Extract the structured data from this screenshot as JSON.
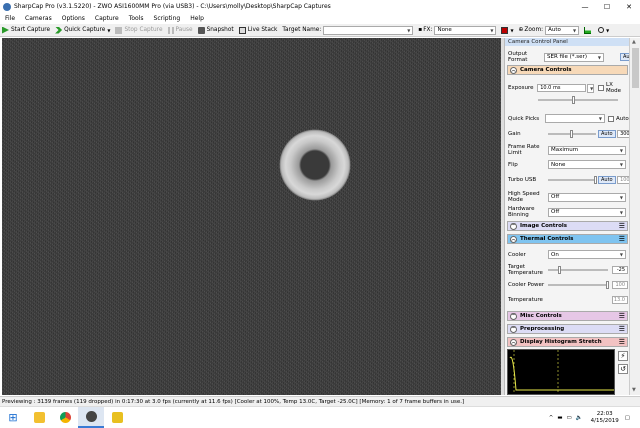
{
  "window": {
    "title": "SharpCap Pro (v3.1.5220) - ZWO ASI1600MM Pro (via USB3) - C:\\Users\\molly\\Desktop\\SharpCap Captures",
    "minimize": "—",
    "maximize": "☐",
    "close": "✕"
  },
  "menu": [
    "File",
    "Cameras",
    "Options",
    "Capture",
    "Tools",
    "Scripting",
    "Help"
  ],
  "toolbar": {
    "start_capture": "Start Capture",
    "quick_capture": "Quick Capture",
    "stop_capture": "Stop Capture",
    "pause": "Pause",
    "snapshot": "Snapshot",
    "live_stack": "Live Stack",
    "target_name_label": "Target Name:",
    "target_name_value": "",
    "fx_label": "FX:",
    "fx_value": "None",
    "zoom_label": "Zoom:",
    "zoom_value": "Auto"
  },
  "panel": {
    "title": "Camera Control Panel",
    "output_format_label": "Output Format",
    "output_format_value": "SER file (*.ser)",
    "auto": "Auto",
    "camera_controls": "Camera Controls",
    "exposure_label": "Exposure",
    "exposure_value": "10.0 ms",
    "lx_mode": "LX Mode",
    "quick_picks_label": "Quick Picks",
    "quick_picks_auto": "Auto",
    "gain_label": "Gain",
    "gain_auto": "Auto",
    "gain_value": "300",
    "frame_rate_label": "Frame Rate Limit",
    "frame_rate_value": "Maximum",
    "flip_label": "Flip",
    "flip_value": "None",
    "turbo_label": "Turbo USB",
    "turbo_auto": "Auto",
    "turbo_value": "100",
    "high_speed_label": "High Speed Mode",
    "high_speed_value": "Off",
    "hw_binning_label": "Hardware Binning",
    "hw_binning_value": "Off",
    "image_controls": "Image Controls",
    "thermal_controls": "Thermal Controls",
    "cooler_label": "Cooler",
    "cooler_value": "On",
    "target_temp_label": "Target Temperature",
    "target_temp_value": "-25",
    "cooler_power_label": "Cooler Power",
    "cooler_power_value": "100",
    "temperature_label": "Temperature",
    "temperature_value": "13.0",
    "misc_controls": "Misc Controls",
    "preprocessing": "Preprocessing",
    "histogram_stretch": "Display Histogram Stretch"
  },
  "status": "Previewing : 3139 frames (119 dropped) in 0:17:30 at 3.0 fps  (currently at 11.6 fps) [Cooler at 100%, Temp 13.0C, Target -25.0C] [Memory: 1 of 7 frame buffers in use.]",
  "taskbar": {
    "time": "22:03",
    "date": "4/15/2019"
  },
  "colors": {
    "camera_controls_bg": "#f7d9b8",
    "image_controls_bg": "#dcdcf5",
    "thermal_controls_bg": "#7fc4f0",
    "misc_controls_bg": "#e6c7e6",
    "preprocessing_bg": "#dcdcf5",
    "histogram_bg": "#f2c2c2"
  },
  "levels": {
    "exposure_slider": 0.45,
    "gain_slider": 0.5,
    "turbo_slider": 1.0,
    "target_temp_slider": 0.2,
    "cooler_power_slider": 1.0
  }
}
